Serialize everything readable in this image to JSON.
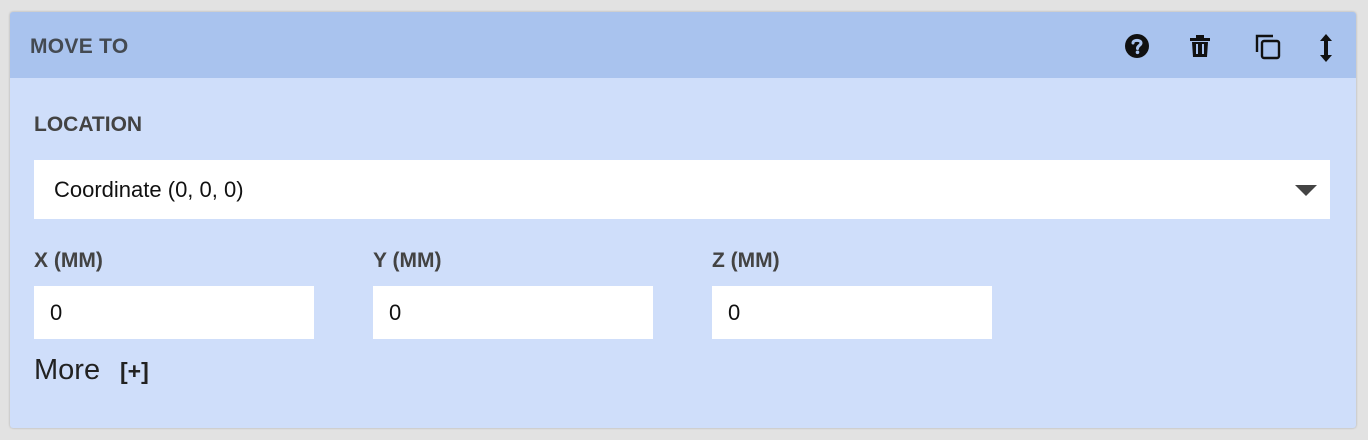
{
  "step": {
    "title": "MOVE TO",
    "icons": [
      "help-icon",
      "trash-icon",
      "duplicate-icon",
      "reorder-icon"
    ]
  },
  "location": {
    "label": "LOCATION",
    "selected": "Coordinate (0, 0, 0)"
  },
  "fields": {
    "x": {
      "label": "X (MM)",
      "value": "0"
    },
    "y": {
      "label": "Y (MM)",
      "value": "0"
    },
    "z": {
      "label": "Z (MM)",
      "value": "0"
    }
  },
  "more": {
    "label": "More",
    "toggle": "[+]"
  },
  "colors": {
    "header": "#a9c3ee",
    "body": "#cfdefa",
    "page": "#e2e2e2"
  }
}
